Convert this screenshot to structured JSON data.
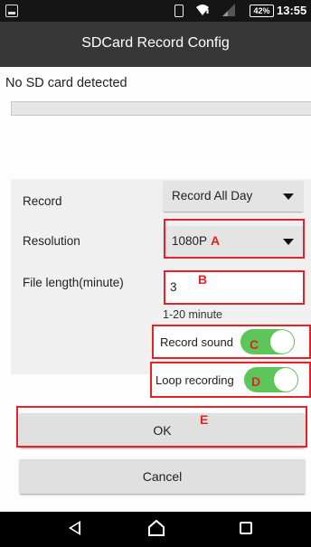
{
  "status_bar": {
    "battery": "42%",
    "time": "13:55"
  },
  "title": "SDCard Record Config",
  "sd_status": "No SD card detected",
  "record": {
    "label": "Record",
    "value": "Record All Day"
  },
  "resolution": {
    "label": "Resolution",
    "value": "1080P"
  },
  "file_length": {
    "label": "File length(minute)",
    "value": "3",
    "hint": "1-20 minute"
  },
  "record_sound": {
    "label": "Record sound",
    "on": true
  },
  "loop_recording": {
    "label": "Loop recording",
    "on": true
  },
  "buttons": {
    "ok": "OK",
    "cancel": "Cancel"
  },
  "annotations": {
    "a": "A",
    "b": "B",
    "c": "C",
    "d": "D",
    "e": "E"
  },
  "colors": {
    "toggle_on": "#5cc65a",
    "annotation": "#e42229",
    "title_bar": "#373737"
  },
  "icons": [
    "sd-card-icon",
    "vibrate-icon",
    "wifi-icon",
    "signal-icon",
    "battery-icon",
    "back-icon",
    "home-icon",
    "recents-icon"
  ]
}
